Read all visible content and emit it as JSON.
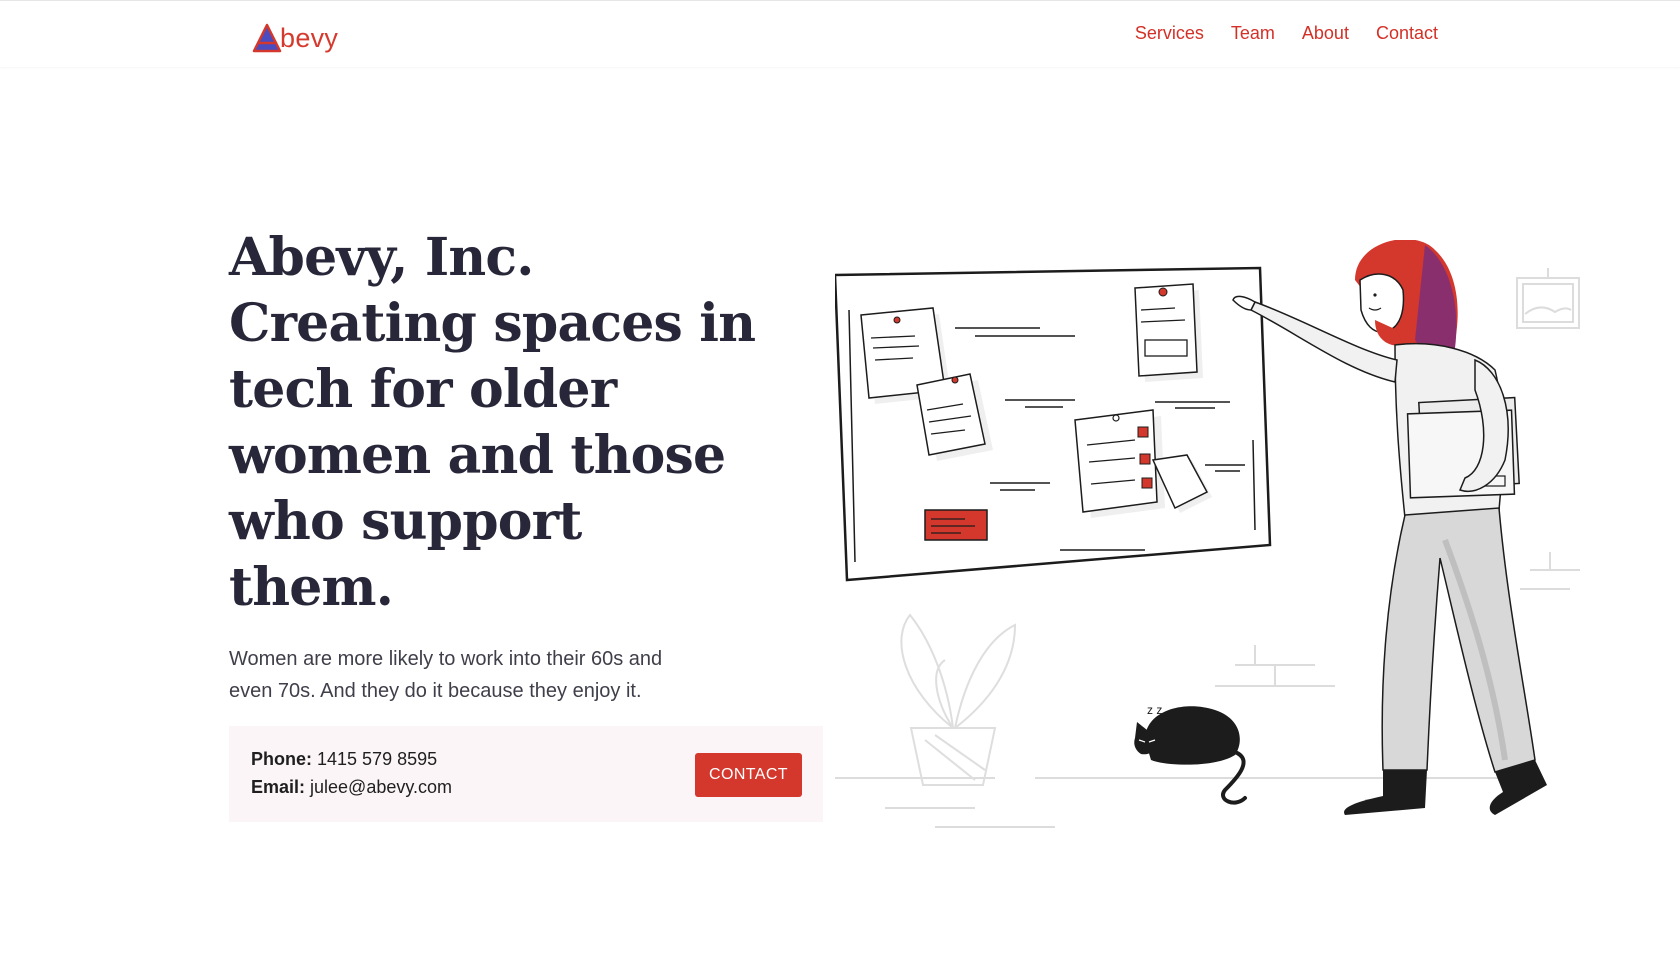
{
  "brand": {
    "logo_text": "bevy",
    "accent_color": "#d4372c",
    "logo_triangle_color": "#4a4cc0"
  },
  "nav": {
    "items": [
      {
        "label": "Services"
      },
      {
        "label": "Team"
      },
      {
        "label": "About"
      },
      {
        "label": "Contact"
      }
    ]
  },
  "hero": {
    "title_lines": [
      "Abevy, Inc.",
      "Creating spaces in",
      "tech for older",
      "women and those",
      "who support",
      "them."
    ],
    "subtitle": "Women are more likely to work into their 60s and even 70s. And they do it because they enjoy it."
  },
  "contact": {
    "phone_label": "Phone:",
    "phone_value": "1415 579 8595",
    "email_label": "Email:",
    "email_value": "julee@abevy.com",
    "button_label": "CONTACT"
  },
  "illustration": {
    "icons": [
      "whiteboard-icon",
      "woman-pointing-icon",
      "sleeping-cat-icon",
      "plant-icon",
      "picture-frame-icon"
    ]
  }
}
